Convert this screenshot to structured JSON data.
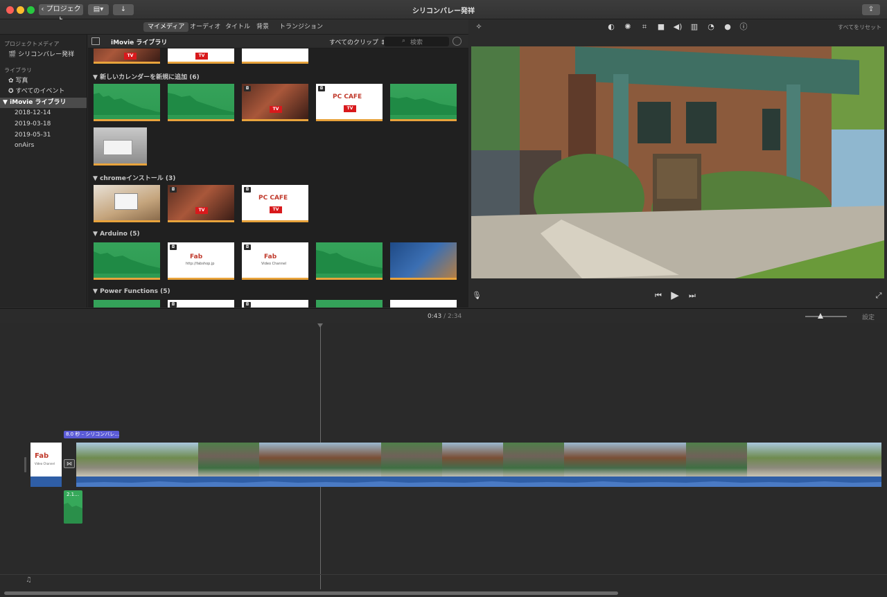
{
  "window": {
    "back_button": "プロジェクト",
    "title": "シリコンバレー発祥"
  },
  "media_tabs": [
    "マイメディア",
    "オーディオ",
    "タイトル",
    "背景",
    "トランジション"
  ],
  "sidebar": {
    "project_media_heading": "プロジェクトメディア",
    "project_item": "シリコンバレー発祥",
    "library_heading": "ライブラリ",
    "photos": "写真",
    "all_events": "すべてのイベント",
    "library_name": "iMovie ライブラリ",
    "events": [
      "2018-12-14",
      "2019-03-18",
      "2019-05-31",
      "onAirs"
    ]
  },
  "browser": {
    "title": "iMovie ライブラリ",
    "filter": "すべてのクリップ",
    "search_placeholder": "検索",
    "sections": [
      {
        "name": "新しいカレンダーを新規に追加",
        "count": "(6)"
      },
      {
        "name": "chromeインストール",
        "count": "(3)"
      },
      {
        "name": "Arduino",
        "count": "(5)"
      },
      {
        "name": "Power Functions",
        "count": "(5)"
      }
    ],
    "pc_cafe_logo": "PC CAFE",
    "tv_badge": "TV",
    "fab_url": "http://fabshop.jp",
    "fab_channel": "Video Channel"
  },
  "viewer": {
    "reset_all": "すべてをリセット"
  },
  "timeline": {
    "current_time": "0:43",
    "separator": "/",
    "total_time": "2:34",
    "settings": "設定",
    "title_clip_label": "8.0 秒 – シリコンバレ…",
    "audio_clip_label": "2.1…",
    "fab_logo": "Fab",
    "fab_channel": "Video Channel"
  },
  "colors": {
    "accent_blue": "#5b5bd6",
    "audio_green": "#36a85a",
    "audio_track": "#2f5ea6",
    "underline_orange": "#e8a33c"
  }
}
